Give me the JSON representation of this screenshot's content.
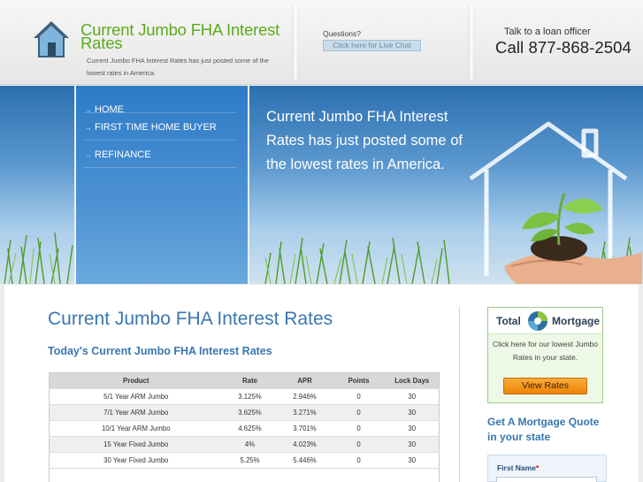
{
  "header": {
    "site_title": "Current Jumbo FHA Interest Rates",
    "tagline": "Current Jumbo FHA Interest Rates has just posted some of the lowest rates in America.",
    "questions_label": "Questions?",
    "chat_button": "Click here for Live Chat",
    "talk_label": "Talk to a loan officer",
    "phone": "Call 877-868-2504"
  },
  "nav": {
    "items": [
      {
        "label": "HOME"
      },
      {
        "label": "FIRST TIME HOME BUYER"
      },
      {
        "label": "REFINANCE"
      }
    ]
  },
  "banner": {
    "text": "Current Jumbo FHA Interest Rates has just posted some of the lowest rates in America."
  },
  "main": {
    "title": "Current Jumbo FHA Interest Rates",
    "subtitle": "Today's Current Jumbo FHA Interest Rates",
    "table": {
      "headers": [
        "Product",
        "Rate",
        "APR",
        "Points",
        "Lock Days"
      ],
      "rows": [
        [
          "5/1 Year ARM Jumbo",
          "3.125%",
          "2.946%",
          "0",
          "30"
        ],
        [
          "7/1 Year ARM Jumbo",
          "3.625%",
          "3.271%",
          "0",
          "30"
        ],
        [
          "10/1 Year ARM Jumbo",
          "4.625%",
          "3.701%",
          "0",
          "30"
        ],
        [
          "15 Year Fixed Jumbo",
          "4%",
          "4.023%",
          "0",
          "30"
        ],
        [
          "30 Year Fixed Jumbo",
          "5.25%",
          "5.446%",
          "0",
          "30"
        ]
      ]
    }
  },
  "sidebar": {
    "logo_left": "Total",
    "logo_right": "Mortgage",
    "promo_text": "Click here for our lowest Jumbo Rates in your state.",
    "view_button": "View Rates",
    "quote_heading": "Get A Mortgage Quote in your state",
    "form_label": "First Name",
    "form_required": "*"
  },
  "colors": {
    "title_green": "#5cab1a",
    "heading_blue": "#3a77b0",
    "nav_blue": "#3a86cc",
    "button_orange": "#f59a1e"
  }
}
